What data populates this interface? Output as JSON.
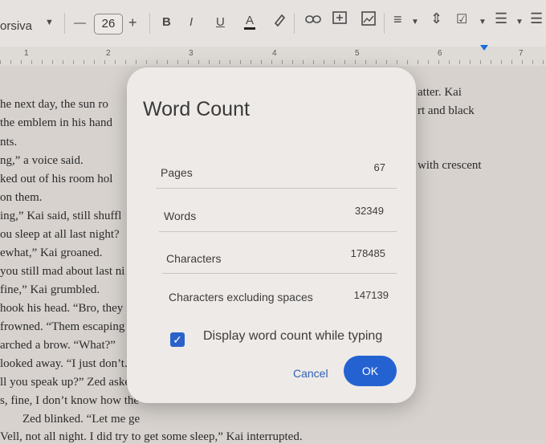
{
  "toolbar": {
    "font_name": "orsiva",
    "font_size": "26",
    "minus": "—",
    "plus": "+",
    "bold": "B",
    "italic": "I",
    "underline": "U",
    "text_color": "A"
  },
  "ruler": {
    "numbers": [
      "1",
      "2",
      "3",
      "4",
      "5",
      "6",
      "7"
    ]
  },
  "document": {
    "lines": [
      "he next day, the sun ro",
      "the emblem in his hand",
      "nts.",
      "ng,” a voice said.",
      "ked out of his room hol",
      "on them.",
      "ing,” Kai said, still shuffl",
      "ou sleep at all last night?",
      "ewhat,” Kai groaned.",
      "you still mad about last ni",
      "fine,” Kai grumbled.",
      "hook his head. “Bro, they",
      "frowned. “Them escaping i",
      "arched a brow. “What?”",
      "looked away. “I just don’t. .",
      "ll you speak up?” Zed askec",
      "s, fine, I don’t know how the",
      "Zed blinked. “Let me ge",
      "Vell, not all night. I did try to get some sleep,” Kai interrupted."
    ],
    "right_lines": [
      "atter. Kai",
      "rt and black",
      "with crescent"
    ]
  },
  "dialog": {
    "title": "Word Count",
    "rows": [
      {
        "label": "Pages",
        "value": "67"
      },
      {
        "label": "Words",
        "value": "32349"
      },
      {
        "label": "Characters",
        "value": "178485"
      },
      {
        "label": "Characters excluding spaces",
        "value": "147139"
      }
    ],
    "checkbox_label": "Display word count while typing",
    "checkbox_checked": true,
    "cancel_label": "Cancel",
    "ok_label": "OK"
  }
}
